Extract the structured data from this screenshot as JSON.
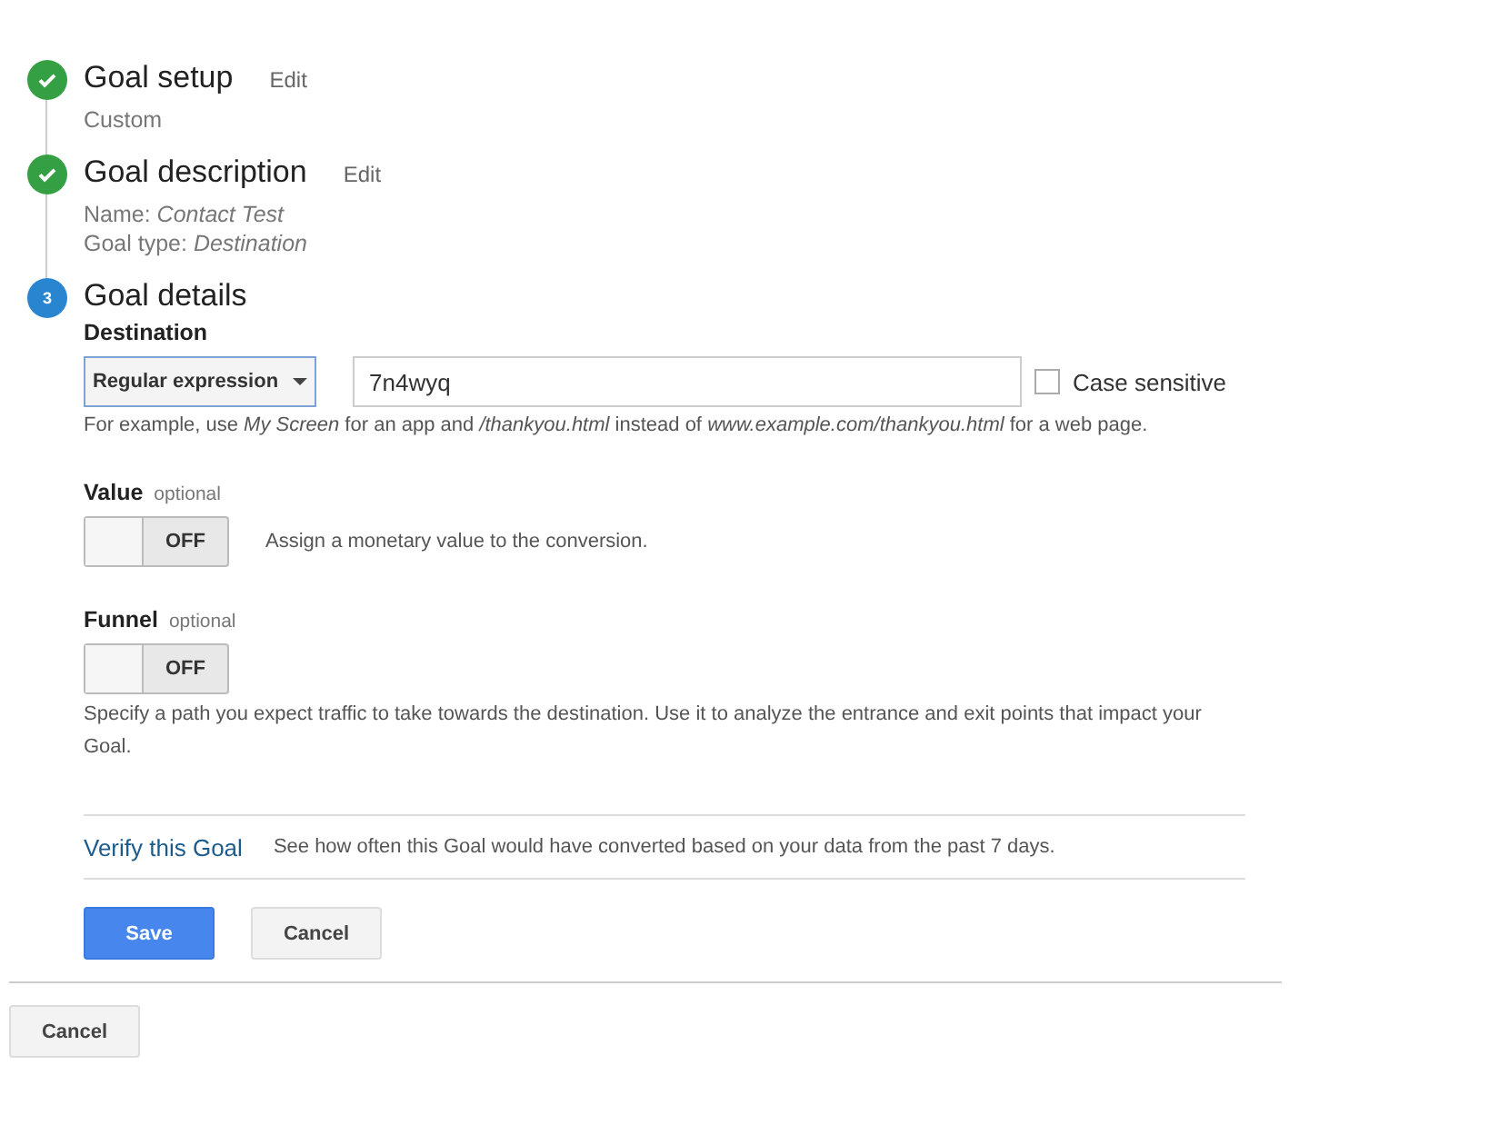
{
  "steps": [
    {
      "kind": "done",
      "title": "Goal setup",
      "edit": "Edit",
      "lines": [
        "Custom"
      ]
    },
    {
      "kind": "done",
      "title": "Goal description",
      "edit": "Edit",
      "lines": [
        "Name: *Contact Test*",
        "Goal type: *Destination*"
      ]
    },
    {
      "kind": "current",
      "number": "3",
      "title": "Goal details"
    }
  ],
  "destination": {
    "label": "Destination",
    "match_type": "Regular expression",
    "value": "7n4wyq",
    "case_sensitive": {
      "label": "Case sensitive",
      "checked": false
    },
    "hint": "For example, use *My Screen* for an app and */thankyou.html* instead of *www.example.com/thankyou.html* for a web page."
  },
  "options": [
    {
      "label": "Value",
      "tag": "optional",
      "toggle": {
        "on": false,
        "text": "OFF"
      },
      "description": "Assign a monetary value to the conversion.",
      "kind": "inline"
    },
    {
      "label": "Funnel",
      "tag": "optional",
      "toggle": {
        "on": false,
        "text": "OFF"
      },
      "description": "Specify a path you expect traffic to take towards the destination. Use it to analyze the entrance and exit points that impact your Goal.",
      "kind": "stacked"
    }
  ],
  "verify": {
    "link": "Verify this Goal",
    "text": "See how often this Goal would have converted based on your data from the past 7 days."
  },
  "buttons": [
    "Save",
    "Cancel"
  ],
  "footer_button": "Cancel"
}
